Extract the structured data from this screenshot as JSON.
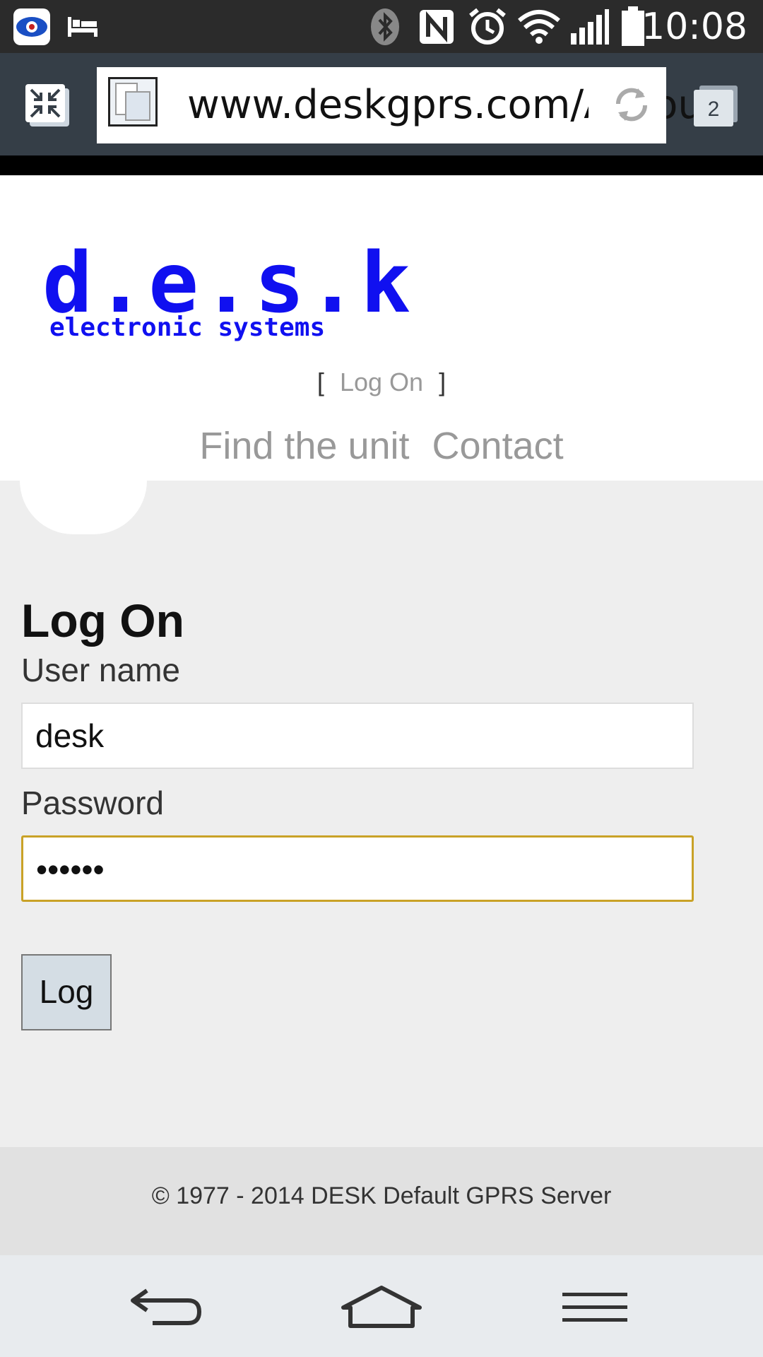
{
  "status_bar": {
    "time": "10:08",
    "icons": [
      "app-eye-icon",
      "bed-icon",
      "bluetooth-icon",
      "nfc-icon",
      "alarm-icon",
      "wifi-icon",
      "signal-icon",
      "battery-icon"
    ]
  },
  "browser": {
    "url": "www.deskgprs.com/Account/LogOn",
    "tab_count": "2"
  },
  "header": {
    "logo_main": "d.e.s.k",
    "logo_sub": "electronic systems",
    "login_bracket_open": "[",
    "login_link": "Log On",
    "login_bracket_close": "]",
    "nav": [
      "Find the unit",
      "Contact"
    ]
  },
  "form": {
    "title": "Log On",
    "username_label": "User name",
    "username_value": "desk",
    "password_label": "Password",
    "password_value": "••••••",
    "submit_label": "Log"
  },
  "footer": {
    "text": "© 1977 - 2014 DESK Default GPRS Server"
  },
  "colors": {
    "logo_blue": "#1010f0",
    "focus_border": "#c9a227",
    "toolbar_bg": "#353e47",
    "status_bg": "#2b2b2b"
  }
}
